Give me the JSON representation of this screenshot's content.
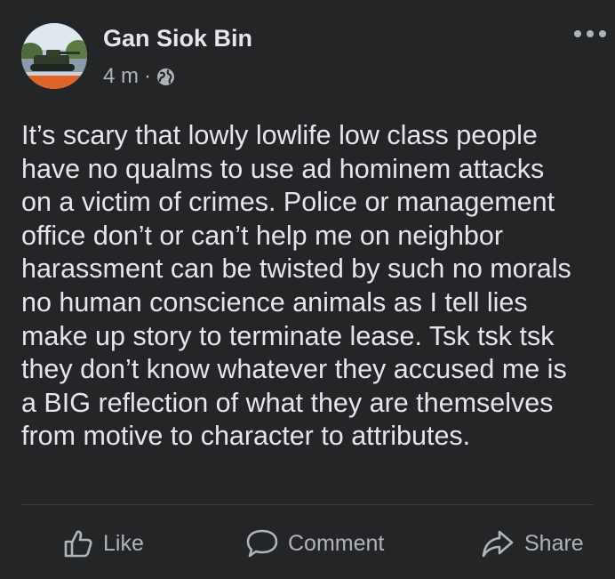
{
  "post": {
    "author": "Gan Siok Bin",
    "timestamp": "4 m",
    "separator": "·",
    "privacy_icon": "globe-icon",
    "more_icon": "more-options-icon",
    "body_lines": [
      "It’s scary that lowly lowlife low class people",
      "have no qualms to use ad hominem attacks",
      "on a victim of crimes. Police or management",
      "office don’t or can’t help me on neighbor",
      "harassment can be twisted by such no morals",
      "no human conscience animals as I tell lies",
      "make up story to terminate lease. Tsk tsk tsk",
      "they don’t know whatever they accused me is",
      "a BIG reflection of what they are themselves",
      "from motive to character to attributes."
    ]
  },
  "actions": {
    "like_label": "Like",
    "comment_label": "Comment",
    "share_label": "Share"
  },
  "colors": {
    "background": "#242526",
    "primary_text": "#e4e6eb",
    "secondary_text": "#b0b3b8",
    "divider": "#3e4042"
  }
}
